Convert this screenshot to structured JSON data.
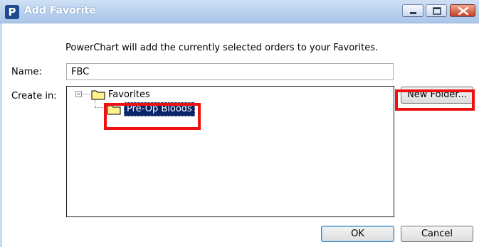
{
  "window": {
    "title": "Add Favorite",
    "app_icon_letter": "P",
    "controls": [
      "minimize-icon",
      "maximize-icon",
      "close-icon"
    ]
  },
  "dialog": {
    "intro_text": "PowerChart will add the currently selected orders to your Favorites.",
    "name_label": "Name:",
    "name_value": "FBC",
    "create_in_label": "Create in:",
    "tree": {
      "root_label": "Favorites",
      "root_icon": "folder-icon",
      "root_expanded": true,
      "children": [
        {
          "label": "Pre-Op Bloods",
          "icon": "folder-icon",
          "selected": true
        }
      ]
    },
    "buttons": {
      "new_folder": "New Folder...",
      "ok": "OK",
      "cancel": "Cancel"
    }
  },
  "colors": {
    "selection_bg": "#0a246a",
    "highlight": "#ee1111",
    "folder_fill": "#fff38a"
  }
}
